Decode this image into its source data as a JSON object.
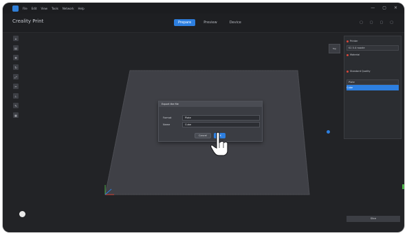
{
  "window": {
    "menu": [
      "File",
      "Edit",
      "View",
      "Tools",
      "Network",
      "Help"
    ],
    "controls": [
      "—",
      "▢",
      "✕"
    ]
  },
  "header": {
    "brand": "Creality Print",
    "tabs": [
      {
        "label": "Prepare",
        "active": true
      },
      {
        "label": "Preview",
        "active": false
      },
      {
        "label": "Device",
        "active": false
      }
    ],
    "right_icons": [
      "▢",
      "▢",
      "▢",
      "▢"
    ]
  },
  "left_toolbar": {
    "icons": [
      "home-icon",
      "import-icon",
      "move-icon",
      "rotate-icon",
      "scale-icon",
      "cut-icon",
      "support-icon",
      "paint-icon",
      "layout-icon"
    ]
  },
  "viewport": {
    "view_cube_label": "Top"
  },
  "dialog": {
    "title": "Export the file",
    "fields": [
      {
        "label": "Format",
        "value": "Plate"
      },
      {
        "label": "Name",
        "value": "Cube"
      }
    ],
    "buttons": [
      {
        "label": "Cancel",
        "primary": false
      },
      {
        "label": "OK",
        "primary": true
      }
    ]
  },
  "right_panel": {
    "printer_label": "Printer",
    "printer_value": "K1 0.4 nozzle",
    "filament_label": "Material",
    "profile_label": "Standard Quality",
    "objects": [
      {
        "name": "Plate",
        "selected": false
      },
      {
        "name": "Cube",
        "selected": true
      }
    ]
  },
  "footer": {
    "slice_button": "Slice"
  },
  "colors": {
    "accent": "#2d7fe0",
    "background": "#222326",
    "panel": "#2b2d31"
  }
}
